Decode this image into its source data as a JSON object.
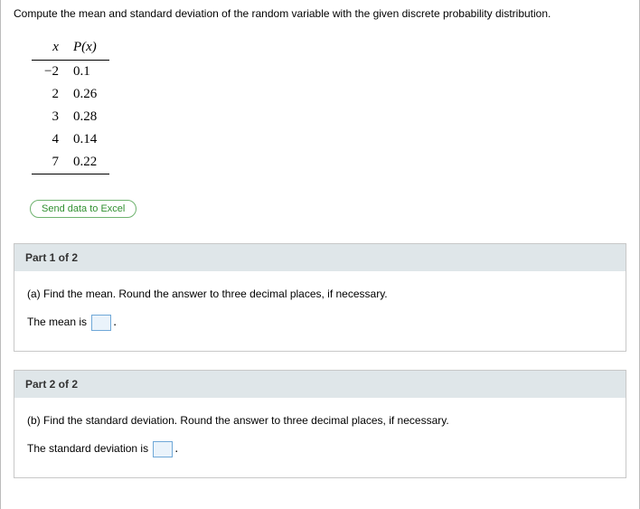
{
  "problem_statement": "Compute the mean and standard deviation of the random variable with the given discrete probability distribution.",
  "table": {
    "header_x": "x",
    "header_p": "P(x)",
    "rows": [
      {
        "x": "−2",
        "p": "0.1"
      },
      {
        "x": "2",
        "p": "0.26"
      },
      {
        "x": "3",
        "p": "0.28"
      },
      {
        "x": "4",
        "p": "0.14"
      },
      {
        "x": "7",
        "p": "0.22"
      }
    ]
  },
  "excel_button": "Send data to Excel",
  "parts": {
    "p1": {
      "header": "Part 1 of 2",
      "question": "(a) Find the mean. Round the answer to three decimal places, if necessary.",
      "answer_prefix": "The mean is",
      "answer_suffix": "."
    },
    "p2": {
      "header": "Part 2 of 2",
      "question": "(b) Find the standard deviation. Round the answer to three decimal places, if necessary.",
      "answer_prefix": "The standard deviation is",
      "answer_suffix": "."
    }
  }
}
